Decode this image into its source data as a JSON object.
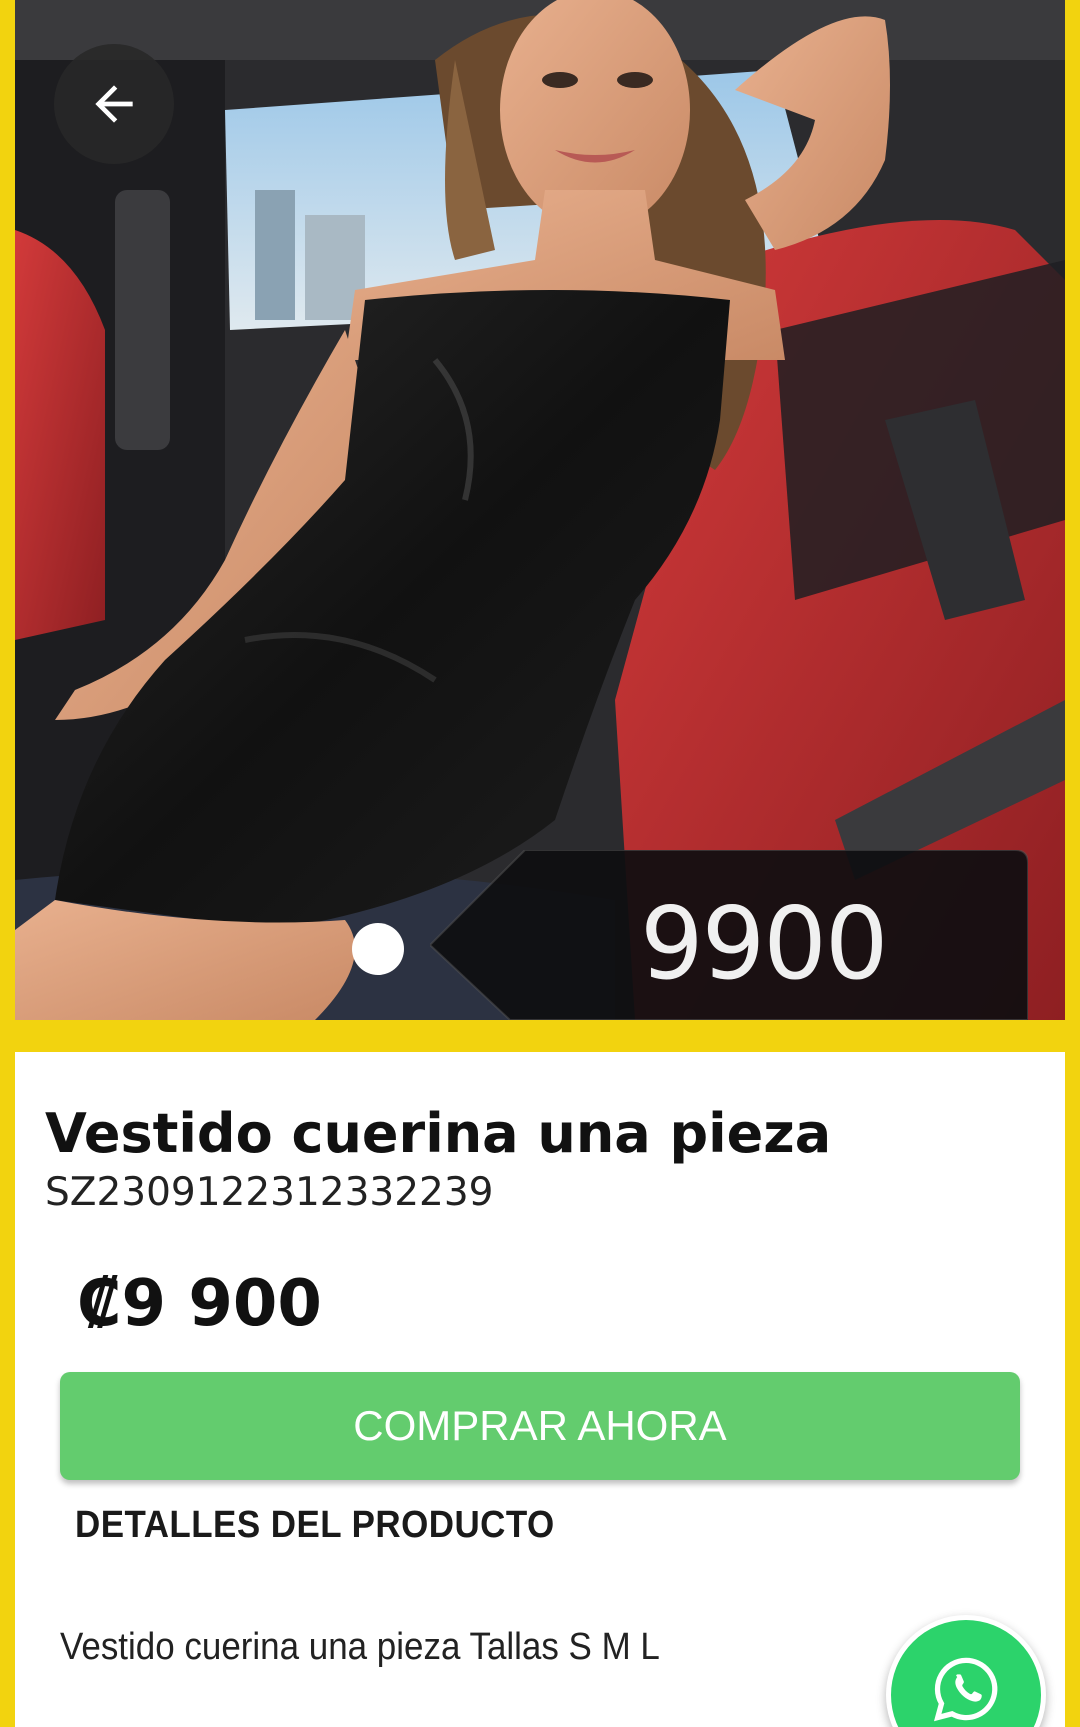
{
  "product": {
    "photo_alt": "product-photo",
    "price_tag": "9900",
    "title": "Vestido cuerina una pieza",
    "sku": "SZ2309122312332239",
    "price": "₡9 900",
    "buy_label": "COMPRAR AHORA",
    "details_heading": "DETALLES DEL PRODUCTO",
    "details_text": "Vestido cuerina una pieza Tallas S M L"
  },
  "carousel": {
    "current": 1,
    "total": 1
  },
  "icons": {
    "back": "arrow-left-icon",
    "whatsapp": "whatsapp-icon"
  },
  "colors": {
    "background": "#f2d30f",
    "buy_button": "#63cc6e",
    "whatsapp": "#2cd36b"
  }
}
